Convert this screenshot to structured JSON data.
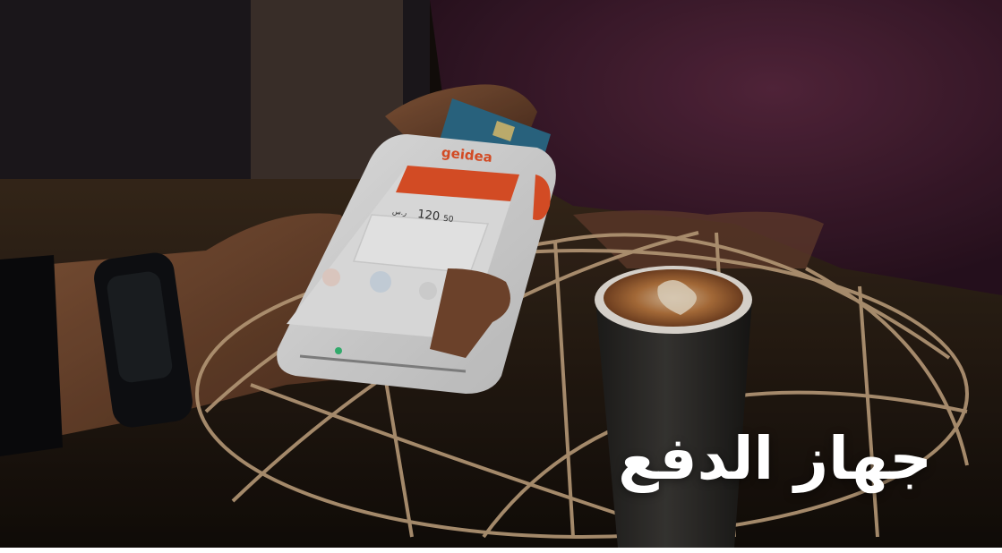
{
  "hero": {
    "title": "جهاز الدفع",
    "title_color": "#ffffff"
  },
  "device": {
    "brand": "geidea",
    "brand_color": "#f0562a",
    "screen_header_color": "#f0562a",
    "amount_value": "120",
    "amount_decimals": "50",
    "currency": "ر.س"
  },
  "colors": {
    "background_dark": "#1c1014",
    "sweater": "#4a1f33",
    "coffee_cup": "#2a2826",
    "latte": "#a2653a",
    "wire_basket": "#c9a983"
  },
  "icons": {
    "pos_terminal": "pos-terminal-icon",
    "card": "credit-card-icon",
    "coffee": "coffee-cup-icon"
  }
}
